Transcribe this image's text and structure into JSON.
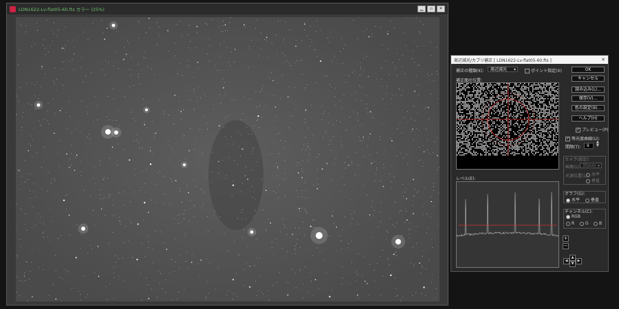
{
  "image_window": {
    "title": "LDN1622-Lv-flat05-60.fts カラー (25%)",
    "buttons": {
      "minimize": "▁",
      "maximize": "▫",
      "close": "✕"
    }
  },
  "dialog": {
    "title": "周辺減光/カブリ補正 [ LDN1622-Lv-flat05-60.fts ]",
    "close": "✕",
    "type_label": "補正の種類(K):",
    "type_value": "周辺減光",
    "point_spec_label": "ポイント指定(X)",
    "center_label": "補正面の位置:",
    "level_label": "レベル(E):",
    "buttons": {
      "ok": "OK",
      "cancel": "キャンセル",
      "load": "読み込み(L)...",
      "save": "保存(V)...",
      "color_settings": "色の設定(B)...",
      "help": "ヘルプ(H)"
    },
    "preview_label": "プレビュー(P)",
    "iso_label": "等光度曲線(U):",
    "interval_label": "間隔(T):",
    "interval_value": "8",
    "camera_group": "カメラ(設定):",
    "angle_label": "画角(L):",
    "angle_value": "35mm",
    "direction_label": "光源位置(L):",
    "dir_opt1": "水平",
    "dir_opt2": "垂直",
    "graph_group": "グラフ(G):",
    "graph_opt1": "水平",
    "graph_opt2": "垂直",
    "channel_group": "チャンネル(C):",
    "ch_rgb": "RGB",
    "ch_r": "R",
    "ch_g": "G",
    "ch_b": "B",
    "plus": "+",
    "minus": "−",
    "arrow_up": "▲",
    "arrow_down": "▼",
    "arrow_left": "◀",
    "arrow_right": "▶",
    "caret": "▾"
  }
}
